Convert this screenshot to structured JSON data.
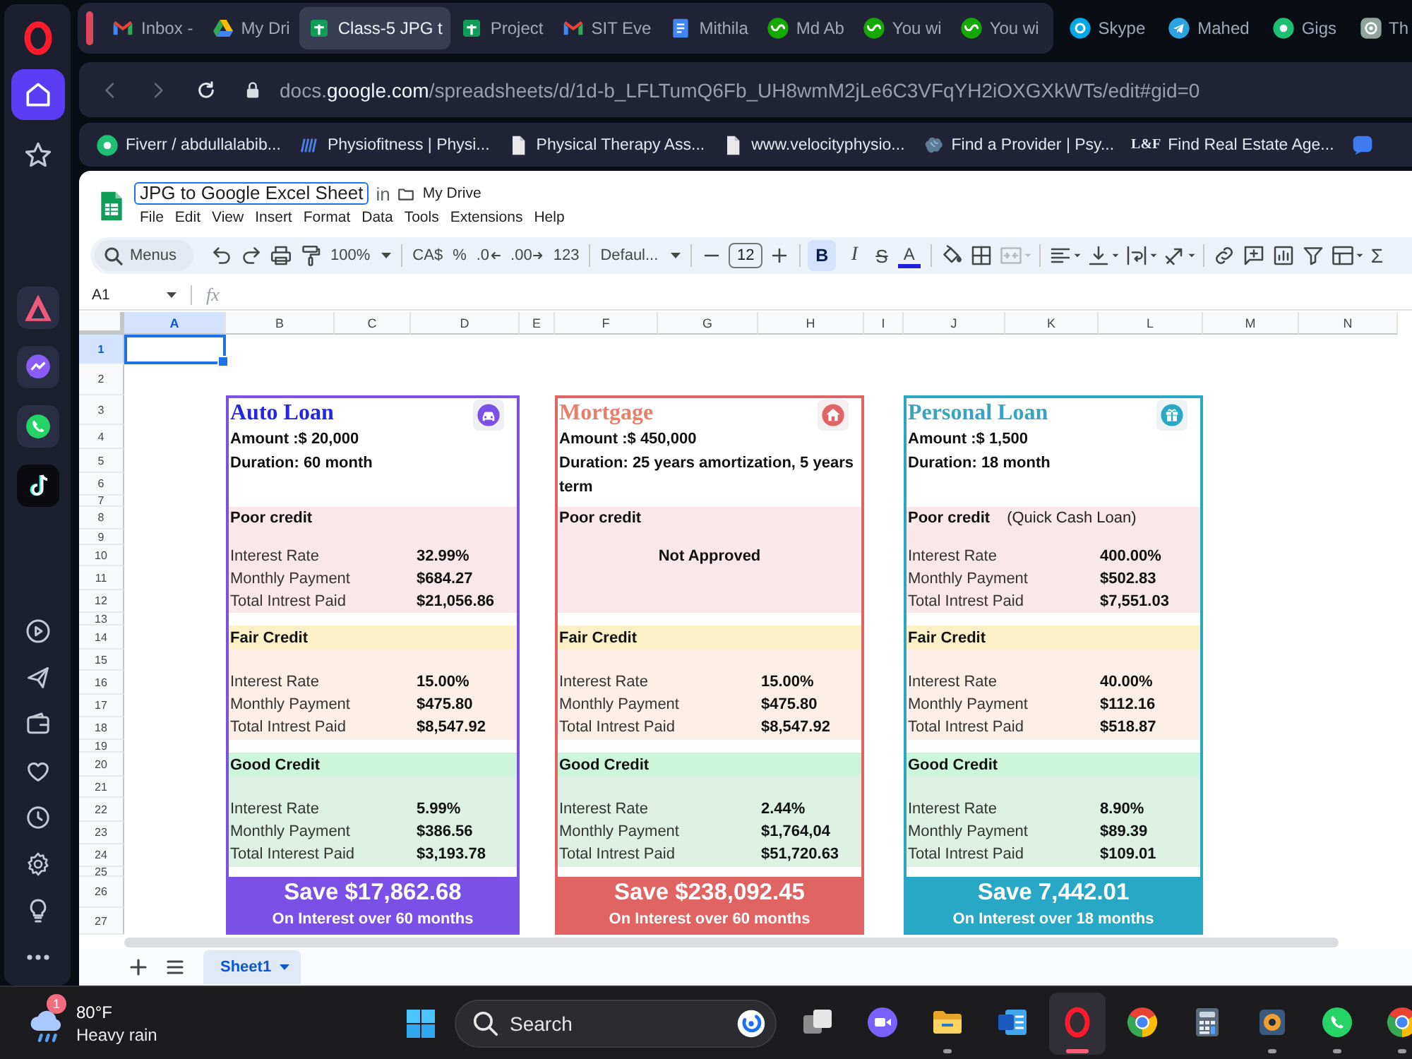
{
  "sidebar": {
    "top": [
      {
        "kind": "home",
        "selected": true
      },
      {
        "kind": "star",
        "selected": false
      }
    ],
    "apps": [
      {
        "kind": "aria",
        "selected": false
      },
      {
        "kind": "messenger",
        "selected": false
      },
      {
        "kind": "whatsapp",
        "selected": false
      },
      {
        "kind": "tiktok",
        "selected": false
      }
    ],
    "tools": [
      {
        "kind": "player",
        "selected": false
      },
      {
        "kind": "send",
        "selected": false
      },
      {
        "kind": "wallet",
        "selected": false
      },
      {
        "kind": "heart",
        "selected": false
      },
      {
        "kind": "history",
        "selected": false
      },
      {
        "kind": "settings",
        "selected": false
      },
      {
        "kind": "bulb",
        "selected": false
      },
      {
        "kind": "more",
        "selected": false
      }
    ]
  },
  "tab_island": {
    "tabs": [
      {
        "kind": "mail",
        "title": "Inbox -",
        "selected": false
      },
      {
        "kind": "drive",
        "title": "My Dri",
        "selected": false
      },
      {
        "kind": "sheet",
        "title": "Class-5 JPG t",
        "selected": true
      },
      {
        "kind": "sheet",
        "title": "Project",
        "selected": false
      },
      {
        "kind": "mail",
        "title": "SIT Eve",
        "selected": false
      },
      {
        "kind": "doc",
        "title": "Mithila",
        "selected": false
      },
      {
        "kind": "upwork",
        "title": "Md Ab",
        "selected": false
      },
      {
        "kind": "upwork",
        "title": "You wi",
        "selected": false
      },
      {
        "kind": "upwork",
        "title": "You wi",
        "selected": false
      }
    ]
  },
  "tabs": [
    {
      "kind": "skype",
      "title": "Skype",
      "selected": false
    },
    {
      "kind": "telegram",
      "title": "Mahed",
      "selected": false
    },
    {
      "kind": "fiverr",
      "title": "Gigs",
      "selected": false
    },
    {
      "kind": "ai",
      "title": "Th",
      "selected": false
    }
  ],
  "address_bar": {
    "back_disabled": true,
    "forward_disabled": true,
    "url": {
      "subdomain": "docs.",
      "domain": "google.com",
      "path": "/spreadsheets/d/1d-b_LFLTumQ6Fb_UH8wmM2jLe6C3VFqYH2iOXGXkWTs/edit#gid=0"
    }
  },
  "bookmarks": [
    {
      "kind": "fiverr",
      "title": "Fiverr / abdullalabib..."
    },
    {
      "kind": "stripes",
      "title": "Physiofitness | Physi..."
    },
    {
      "kind": "page",
      "title": "Physical Therapy Ass..."
    },
    {
      "kind": "page",
      "title": "www.velocityphysio..."
    },
    {
      "kind": "brain",
      "title": "Find a Provider | Psy..."
    },
    {
      "kind": "logo",
      "logo_text": "L&F",
      "title": "Find Real Estate Age..."
    },
    {
      "kind": "bubble"
    }
  ],
  "document": {
    "title": "JPG to Google Excel Sheet",
    "location_prefix": "in",
    "location": "My Drive",
    "menus": [
      "File",
      "Edit",
      "View",
      "Insert",
      "Format",
      "Data",
      "Tools",
      "Extensions",
      "Help"
    ]
  },
  "toolbar": {
    "search_placeholder": "Menus",
    "zoom": "100%",
    "currency": "CA$",
    "percent": "%",
    "decrease_decimals": ".0",
    "increase_decimals": ".00",
    "number_format": "123",
    "font": "Defaul...",
    "font_size": "12",
    "bold": {
      "label": "B",
      "selected": true
    },
    "italic": {
      "label": "I",
      "selected": false
    },
    "strikethrough": {
      "label": "S",
      "selected": false
    },
    "text_color": {
      "label": "A",
      "color": "#1f1fe0"
    },
    "merge_disabled": true,
    "sum": "Σ"
  },
  "formula_bar": {
    "name_box": "A1",
    "fx": "fx"
  },
  "grid": {
    "columns": [
      {
        "label": "A",
        "selected": true
      },
      {
        "label": "B",
        "selected": false
      },
      {
        "label": "C",
        "selected": false
      },
      {
        "label": "D",
        "selected": false
      },
      {
        "label": "E",
        "selected": false
      },
      {
        "label": "F",
        "selected": false
      },
      {
        "label": "G",
        "selected": false
      },
      {
        "label": "H",
        "selected": false
      },
      {
        "label": "I",
        "selected": false
      },
      {
        "label": "J",
        "selected": false
      },
      {
        "label": "K",
        "selected": false
      },
      {
        "label": "L",
        "selected": false
      },
      {
        "label": "M",
        "selected": false
      },
      {
        "label": "N",
        "selected": false
      }
    ],
    "rows": [
      {
        "label": "1",
        "selected": true
      },
      {
        "label": "2",
        "selected": false
      },
      {
        "label": "3",
        "selected": false
      },
      {
        "label": "4",
        "selected": false
      },
      {
        "label": "5",
        "selected": false
      },
      {
        "label": "6",
        "selected": false
      },
      {
        "label": "7",
        "selected": false
      },
      {
        "label": "8",
        "selected": false
      },
      {
        "label": "9",
        "selected": false
      },
      {
        "label": "10",
        "selected": false
      },
      {
        "label": "11",
        "selected": false
      },
      {
        "label": "12",
        "selected": false
      },
      {
        "label": "13",
        "selected": false
      },
      {
        "label": "14",
        "selected": false
      },
      {
        "label": "15",
        "selected": false
      },
      {
        "label": "16",
        "selected": false
      },
      {
        "label": "17",
        "selected": false
      },
      {
        "label": "18",
        "selected": false
      },
      {
        "label": "19",
        "selected": false
      },
      {
        "label": "20",
        "selected": false
      },
      {
        "label": "21",
        "selected": false
      },
      {
        "label": "22",
        "selected": false
      },
      {
        "label": "23",
        "selected": false
      },
      {
        "label": "24",
        "selected": false
      },
      {
        "label": "25",
        "selected": false
      },
      {
        "label": "26",
        "selected": false
      },
      {
        "label": "27",
        "selected": false
      }
    ]
  },
  "cards": [
    {
      "kind": "auto",
      "title": {
        "text": "Auto Loan",
        "color": "#2525e6"
      },
      "color": "#7b50e6",
      "amount": "Amount :$ 20,000",
      "duration": "Duration: 60 month",
      "sections": [
        {
          "kind": "poor",
          "label": "Poor credit",
          "rows": [
            {
              "label": "Interest Rate",
              "value": "32.99%"
            },
            {
              "label": "Monthly Payment",
              "value": "$684.27"
            },
            {
              "label": "Total Intrest Paid",
              "value": "$21,056.86"
            }
          ]
        },
        {
          "kind": "fair",
          "label": "Fair Credit",
          "rows": [
            {
              "label": "Interest Rate",
              "value": "15.00%"
            },
            {
              "label": "Monthly Payment",
              "value": "$475.80"
            },
            {
              "label": "Total Intrest Paid",
              "value": "$8,547.92"
            }
          ]
        },
        {
          "kind": "good",
          "label": "Good Credit",
          "rows": [
            {
              "label": "Interest Rate",
              "value": "5.99%"
            },
            {
              "label": "Monthly Payment",
              "value": "$386.56"
            },
            {
              "label": "Total Interest Paid",
              "value": "$3,193.78"
            }
          ]
        }
      ],
      "savings": "Save $17,862.68",
      "savings_note": "On Interest over 60 months"
    },
    {
      "kind": "mortgage",
      "title": {
        "text": "Mortgage",
        "color": "#e6806c"
      },
      "color": "#e06464",
      "amount": "Amount :$ 450,000",
      "duration": "Duration: 25 years amortization, 5 years term",
      "sections": [
        {
          "kind": "poor",
          "label": "Poor credit",
          "message": "Not Approved"
        },
        {
          "kind": "fair",
          "label": "Fair Credit",
          "rows": [
            {
              "label": "Interest Rate",
              "value": "15.00%"
            },
            {
              "label": "Monthly Payment",
              "value": "$475.80"
            },
            {
              "label": "Total Intrest Paid",
              "value": "$8,547.92"
            }
          ]
        },
        {
          "kind": "good",
          "label": "Good Credit",
          "rows": [
            {
              "label": "Interest Rate",
              "value": "2.44%"
            },
            {
              "label": "Monthly Payment",
              "value": "$1,764,04"
            },
            {
              "label": "Total Intrest Paid",
              "value": "$51,720.63"
            }
          ]
        }
      ],
      "savings": "Save $238,092.45",
      "savings_note": "On Interest over 60 months"
    },
    {
      "kind": "personal",
      "title": {
        "text": "Personal Loan",
        "color": "#3aa3bf"
      },
      "color": "#28a8c4",
      "amount": "Amount :$ 1,500",
      "duration": "Duration: 18 month",
      "sections": [
        {
          "kind": "poor",
          "label": "Poor credit",
          "note": "(Quick Cash Loan)",
          "rows": [
            {
              "label": "Interest Rate",
              "value": "400.00%"
            },
            {
              "label": "Monthly Payment",
              "value": "$502.83"
            },
            {
              "label": "Total Intrest Paid",
              "value": "$7,551.03"
            }
          ]
        },
        {
          "kind": "fair",
          "label": "Fair Credit",
          "rows": [
            {
              "label": "Interest Rate",
              "value": "40.00%"
            },
            {
              "label": "Monthly Payment",
              "value": "$112.16"
            },
            {
              "label": "Total Intrest Paid",
              "value": "$518.87"
            }
          ]
        },
        {
          "kind": "good",
          "label": "Good Credit",
          "rows": [
            {
              "label": "Interest Rate",
              "value": "8.90%"
            },
            {
              "label": "Monthly Payment",
              "value": "$89.39"
            },
            {
              "label": "Total Intrest Paid",
              "value": "$109.01"
            }
          ]
        }
      ],
      "savings": "Save 7,442.01",
      "savings_note": "On Interest over 18 months"
    }
  ],
  "sheet_tabs": [
    {
      "label": "Sheet1",
      "selected": true
    }
  ],
  "taskbar": {
    "weather": {
      "badge": "1",
      "temperature": "80°F",
      "condition": "Heavy rain"
    },
    "search_label": "Search",
    "apps": [
      {
        "kind": "taskview",
        "running": false,
        "selected": false,
        "notified": false
      },
      {
        "kind": "meet",
        "running": false,
        "selected": false,
        "notified": false
      },
      {
        "kind": "folder",
        "running": true,
        "selected": false,
        "notified": false
      },
      {
        "kind": "word",
        "running": false,
        "selected": false,
        "notified": false
      },
      {
        "kind": "opera",
        "running": true,
        "selected": true,
        "notified": false
      },
      {
        "kind": "chrome",
        "running": false,
        "selected": false,
        "notified": false
      },
      {
        "kind": "calculator",
        "running": false,
        "selected": false,
        "notified": false
      },
      {
        "kind": "media",
        "running": true,
        "selected": false,
        "notified": false
      },
      {
        "kind": "whatsapp",
        "running": true,
        "selected": false,
        "notified": false
      },
      {
        "kind": "chrome",
        "running": true,
        "selected": false,
        "notified": true
      }
    ]
  }
}
